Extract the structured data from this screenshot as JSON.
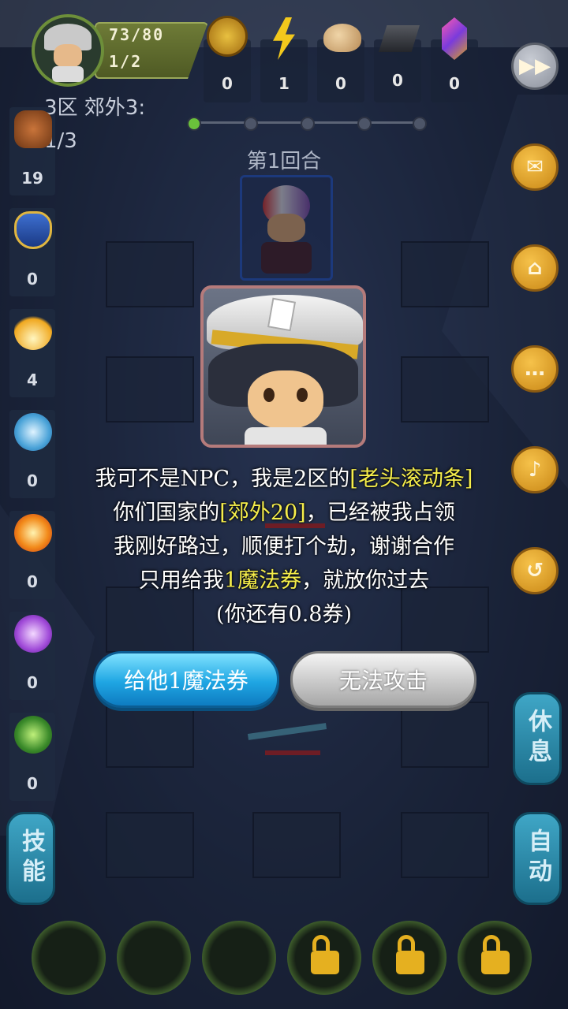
{
  "player": {
    "hp": "73/80",
    "ap": "1/2"
  },
  "resources": [
    {
      "icon": "star-coin-icon",
      "count": "0"
    },
    {
      "icon": "lightning-icon",
      "count": "1"
    },
    {
      "icon": "bread-icon",
      "count": "0"
    },
    {
      "icon": "iron-ingot-icon",
      "count": "0"
    },
    {
      "icon": "crystal-icon",
      "count": "0"
    }
  ],
  "stage": {
    "name": "3区 郊外3:",
    "progress": "1/3"
  },
  "round_label": "第1回合",
  "stats": [
    {
      "icon": "fist-icon",
      "value": "19"
    },
    {
      "icon": "shield-icon",
      "value": "0"
    },
    {
      "icon": "fire-arrow-icon",
      "value": "4"
    },
    {
      "icon": "water-wave-icon",
      "value": "0"
    },
    {
      "icon": "flame-orb-icon",
      "value": "0"
    },
    {
      "icon": "lightning-burst-icon",
      "value": "0"
    },
    {
      "icon": "poison-icon",
      "value": "0"
    }
  ],
  "side_tabs": {
    "skill": "技能",
    "rest": "休息",
    "auto": "自动"
  },
  "dialog": {
    "line1_a": "我可不是NPC，我是2区的",
    "line1_name": "[老头滚动条]",
    "line2_a": "你们国家的",
    "line2_place": "[郊外20]",
    "line2_b": "，已经被我占领",
    "line3": "我刚好路过，顺便打个劫，谢谢合作",
    "line4_a": "只用给我",
    "line4_item": "1魔法券",
    "line4_b": "，就放你过去",
    "line5": "(你还有0.8券)",
    "give_button": "给他1魔法券",
    "refuse_button": "无法攻击"
  },
  "colors": {
    "highlight": "#f6ee4b",
    "give_button": "#1fa6e3",
    "refuse_button": "#c9c9c9"
  }
}
